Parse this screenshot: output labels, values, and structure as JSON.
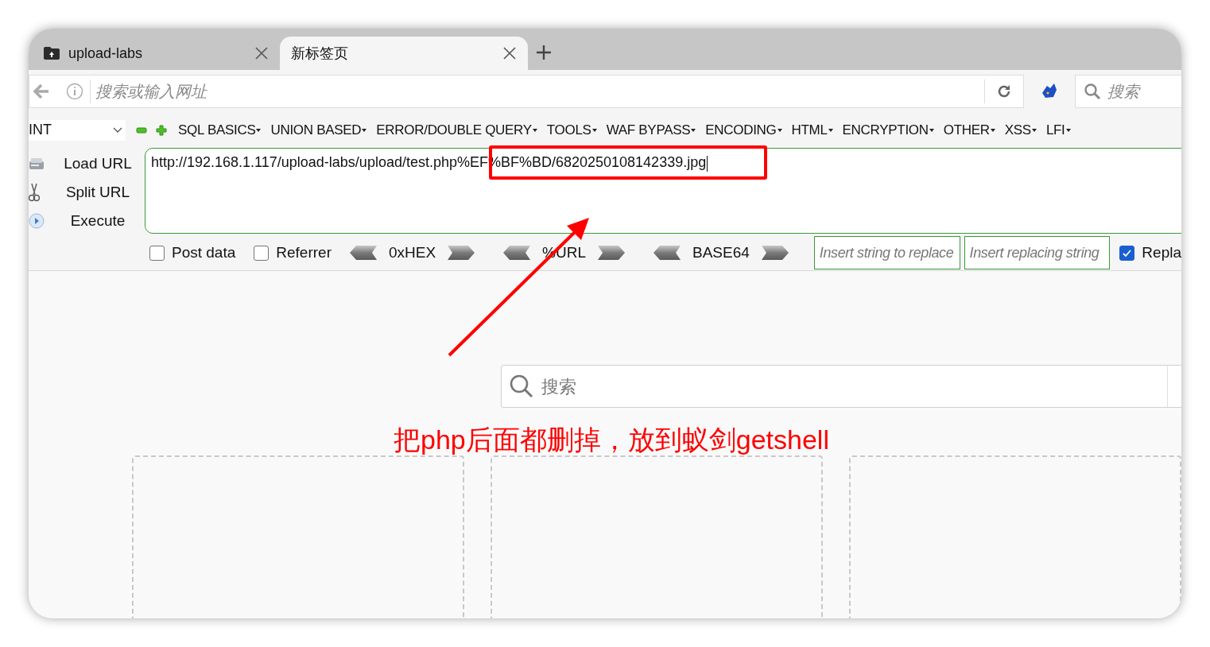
{
  "tabs": [
    {
      "title": "upload-labs",
      "selected": false
    },
    {
      "title": "新标签页",
      "selected": true
    }
  ],
  "address_bar": {
    "placeholder": "搜索或输入网址"
  },
  "search_bar": {
    "placeholder": "搜索"
  },
  "hackbar": {
    "select": "INT",
    "menus": [
      "SQL BASICS",
      "UNION BASED",
      "ERROR/DOUBLE QUERY",
      "TOOLS",
      "WAF BYPASS",
      "ENCODING",
      "HTML",
      "ENCRYPTION",
      "OTHER",
      "XSS",
      "LFI"
    ],
    "actions": [
      {
        "kind": "load",
        "label": "Load URL"
      },
      {
        "kind": "split",
        "label": "Split URL"
      },
      {
        "kind": "execute",
        "label": "Execute"
      }
    ],
    "url": "http://192.168.1.117/upload-labs/upload/test.php%EF%BF%BD/6820250108142339.jpg",
    "checkboxes": [
      {
        "label": "Post data",
        "checked": false
      },
      {
        "label": "Referrer",
        "checked": false
      }
    ],
    "encoders": [
      "0xHEX",
      "%URL",
      "BASE64"
    ],
    "replace_fields": [
      {
        "placeholder": "Insert string to replace"
      },
      {
        "placeholder": "Insert replacing string"
      }
    ],
    "replace_checkbox": {
      "label": "Repla",
      "checked": true
    }
  },
  "page": {
    "search_placeholder": "搜索"
  },
  "annotation": {
    "text": "把php后面都删掉，放到蚁剑getshell"
  }
}
